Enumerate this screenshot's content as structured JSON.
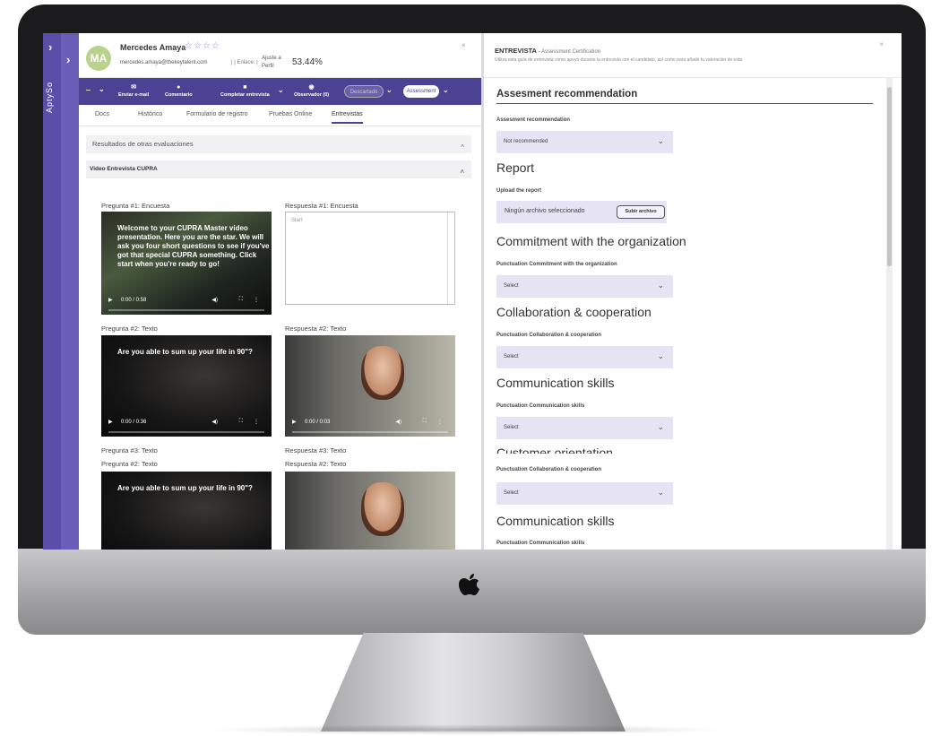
{
  "sidebar": {
    "brand": "AptySo"
  },
  "candidate": {
    "initials": "MA",
    "name": "Mercedes Amaya",
    "stars": "☆☆☆☆",
    "email": "mercedes.amaya@thekeytalent.com",
    "link_label": "|   |  Enlace:  |",
    "fit_label": "Ajuste a Perfil",
    "fit_value": "53.44%",
    "close": "×"
  },
  "toolbar": {
    "send_email": "Enviar e-mail",
    "comment": "Comentario",
    "complete": "Completar entrevista",
    "observer": "Observador (0)",
    "discarded": "Descartado",
    "assessment": "Assessment"
  },
  "tabs": [
    "Docs",
    "Histórico",
    "Formulario de registro",
    "Pruebas Online",
    "Entrevistas"
  ],
  "sections": {
    "other_results": "Resultados de otras evaluaciones",
    "video_interview": "Video Entrevista CUPRA"
  },
  "questions": [
    {
      "q": "Pregunta #1: Encuesta",
      "a": "Respuesta #1: Encuesta",
      "video_text": "Welcome to your CUPRA Master video presentation. Here you are the star. We will ask you four short questions to see if you've got that special CUPRA something. Click start when you're ready to go!",
      "time": "0:00 / 0:58",
      "answer_placeholder": "Start"
    },
    {
      "q": "Pregunta #2: Texto",
      "a": "Respuesta #2: Texto",
      "video_text": "Are you able to sum up your life in 90\"?",
      "time": "0:00 / 0:36",
      "answer_time": "0:00 / 0:03"
    },
    {
      "q": "Pregunta #3: Texto",
      "a": "Respuesta #3: Texto"
    },
    {
      "q": "Pregunta #2: Texto",
      "a": "Respuesta #2: Texto",
      "video_text": "Are you able to sum up your life in 90\"?"
    }
  ],
  "right": {
    "title": "ENTREVISTA",
    "subtitle": "- Assessment Certification",
    "description": "Utiliza esta guía de entrevista como apoyo durante la entrevista con el candidato, así como para añadir tu valoración de esta.",
    "close": "×",
    "section_title": "Assesment recommendation",
    "rec_label": "Assesment recommendation",
    "rec_value": "Not recommended",
    "report_title": "Report",
    "upload_label": "Upload the report",
    "no_file": "Ningún archivo seleccionado",
    "upload_button": "Subir archivo",
    "blocks": [
      {
        "title": "Commitment with the organization",
        "label": "Punctuation Commitment with the organization",
        "value": "Select"
      },
      {
        "title": "Collaboration & cooperation",
        "label": "Punctuation Collaboration & cooperation",
        "value": "Select"
      },
      {
        "title": "Communication skills",
        "label": "Punctuation Communication skills",
        "value": "Select"
      },
      {
        "title": "Customer orientation",
        "label": "Punctuation Collaboration & cooperation",
        "value": "Select"
      },
      {
        "title": "Communication skills",
        "label": "Punctuation Communication skills",
        "value": ""
      }
    ]
  }
}
